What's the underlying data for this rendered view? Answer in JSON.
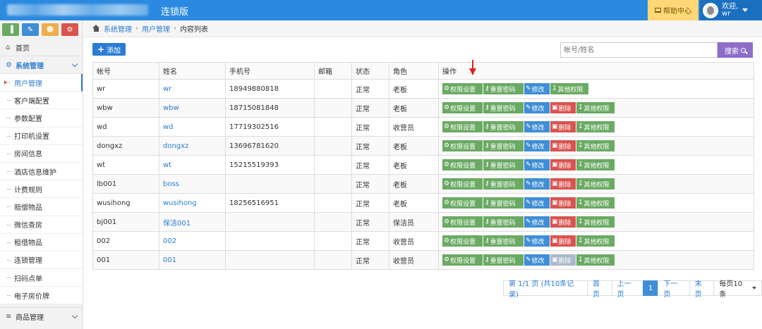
{
  "app": {
    "subtitle": "连锁版"
  },
  "header": {
    "help_label": "帮助中心",
    "welcome": "欢迎,",
    "username": "wr"
  },
  "sidebar": {
    "home": "首页",
    "group": "系统管理",
    "items": [
      "用户管理",
      "客户端配置",
      "参数配置",
      "打印机设置",
      "房间信息",
      "酒店信息维护",
      "计费规则",
      "赔偿物品",
      "微信查房",
      "租借物品",
      "连锁管理",
      "扫码点单",
      "电子房价牌"
    ],
    "bottom_group": "商品管理"
  },
  "breadcrumb": [
    "系统管理",
    "用户管理",
    "内容列表"
  ],
  "toolbar": {
    "add_label": "添加",
    "search_placeholder": "帐号/姓名",
    "search_label": "搜索"
  },
  "table": {
    "headers": [
      "帐号",
      "姓名",
      "手机号",
      "邮箱",
      "状态",
      "角色",
      "操作"
    ],
    "actions": {
      "perm": "权限设置",
      "reset": "重置密码",
      "edit": "修改",
      "delete": "删除",
      "other": "其他权限"
    },
    "rows": [
      {
        "account": "wr",
        "name": "wr",
        "phone": "18949880818",
        "email": "",
        "status": "正常",
        "role": "老板",
        "delete": "none"
      },
      {
        "account": "wbw",
        "name": "wbw",
        "phone": "18715081848",
        "email": "",
        "status": "正常",
        "role": "老板",
        "delete": "active"
      },
      {
        "account": "wd",
        "name": "wd",
        "phone": "17719302516",
        "email": "",
        "status": "正常",
        "role": "收营员",
        "delete": "active"
      },
      {
        "account": "dongxz",
        "name": "dongxz",
        "phone": "13696781620",
        "email": "",
        "status": "正常",
        "role": "老板",
        "delete": "active"
      },
      {
        "account": "wt",
        "name": "wt",
        "phone": "15215519393",
        "email": "",
        "status": "正常",
        "role": "老板",
        "delete": "active"
      },
      {
        "account": "lb001",
        "name": "boss",
        "phone": "",
        "email": "",
        "status": "正常",
        "role": "老板",
        "delete": "active"
      },
      {
        "account": "wusihong",
        "name": "wusihong",
        "phone": "18256516951",
        "email": "",
        "status": "正常",
        "role": "老板",
        "delete": "active"
      },
      {
        "account": "bj001",
        "name": "保洁001",
        "phone": "",
        "email": "",
        "status": "正常",
        "role": "保洁员",
        "delete": "active"
      },
      {
        "account": "002",
        "name": "002",
        "phone": "",
        "email": "",
        "status": "正常",
        "role": "收营员",
        "delete": "active"
      },
      {
        "account": "001",
        "name": "001",
        "phone": "",
        "email": "",
        "status": "正常",
        "role": "收营员",
        "delete": "disabled"
      }
    ]
  },
  "pagination": {
    "info": "第 1/1 页 (共10条记录)",
    "first": "首页",
    "prev": "上一页",
    "current": "1",
    "next": "下一页",
    "last": "末页",
    "page_size": "每页10条"
  },
  "colors": {
    "primary": "#2b8ae0",
    "success": "#6aaa63",
    "danger": "#d9534f",
    "help_bg": "#ffd777"
  }
}
